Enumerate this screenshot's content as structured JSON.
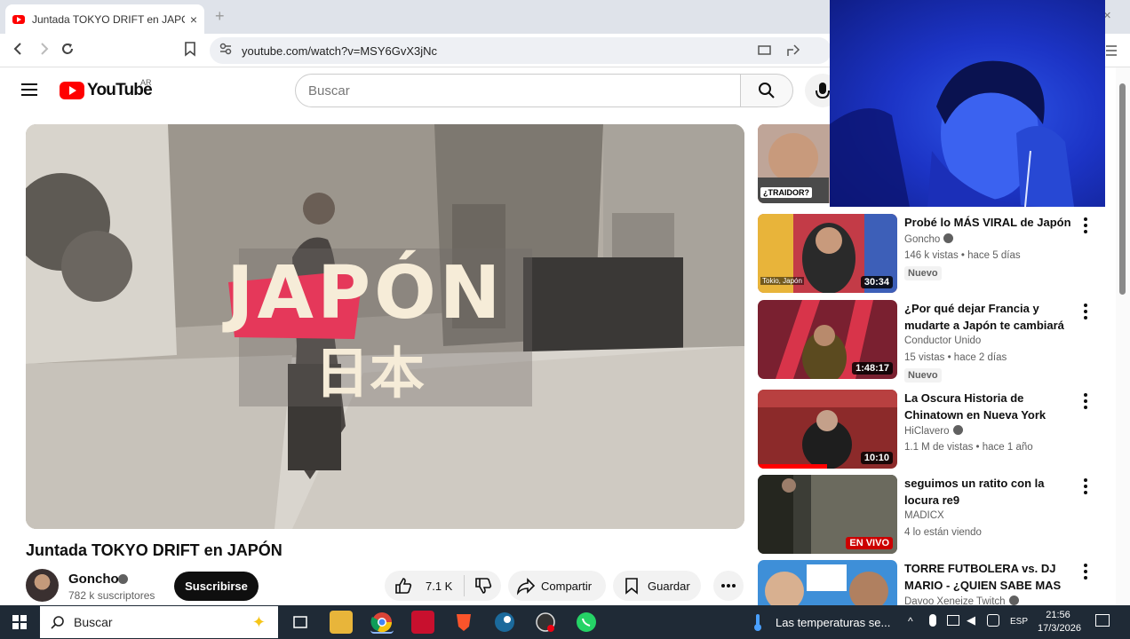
{
  "browser": {
    "tab_title": "Juntada TOKYO DRIFT en JAPÓN",
    "tab_close": "×",
    "new_tab": "+",
    "window_close": "×",
    "url": "youtube.com/watch?v=MSY6GvX3jNc"
  },
  "youtube": {
    "logo_text": "YouTube",
    "country_code": "AR",
    "search_placeholder": "Buscar"
  },
  "video": {
    "thumbnail_title": "JAPÓN",
    "thumbnail_kanji": "日本",
    "title": "Juntada TOKYO DRIFT en JAPÓN",
    "channel": "Goncho",
    "subscribers": "782 k suscriptores",
    "subscribe_label": "Suscribirse",
    "likes": "7.1 K",
    "share_label": "Compartir",
    "save_label": "Guardar"
  },
  "suggestions": [
    {
      "title": "Probé lo MÁS VIRAL de Japón",
      "channel": "Goncho",
      "verified": true,
      "meta": "146 k vistas • hace 5 días",
      "badge": "Nuevo",
      "duration": "30:34",
      "thumb_tag": "Tokio, Japón"
    },
    {
      "title": "¿Por qué dejar Francia y mudarte a Japón te cambiará l...",
      "channel": "Conductor Unido",
      "verified": false,
      "meta": "15 vistas • hace 2 días",
      "badge": "Nuevo",
      "duration": "1:48:17"
    },
    {
      "title": "La Oscura Historia de Chinatown en Nueva York",
      "channel": "HiClavero",
      "verified": true,
      "meta": "1.1 M de vistas • hace 1 año",
      "duration": "10:10"
    },
    {
      "title": "seguimos un ratito con la locura re9",
      "channel": "MADICX",
      "verified": false,
      "meta": "4 lo están viendo",
      "live": "EN VIVO"
    },
    {
      "title": "TORRE FUTBOLERA vs. DJ MARIO - ¿QUIEN SABE MAS D...",
      "channel": "Davoo Xeneize Twitch",
      "verified": true
    }
  ],
  "top_thumb_text": "¿TRAIDOR?",
  "taskbar": {
    "search_placeholder": "Buscar",
    "weather": "Las temperaturas se...",
    "language": "ESP",
    "time": "21:56",
    "date": "17/3/2026"
  }
}
